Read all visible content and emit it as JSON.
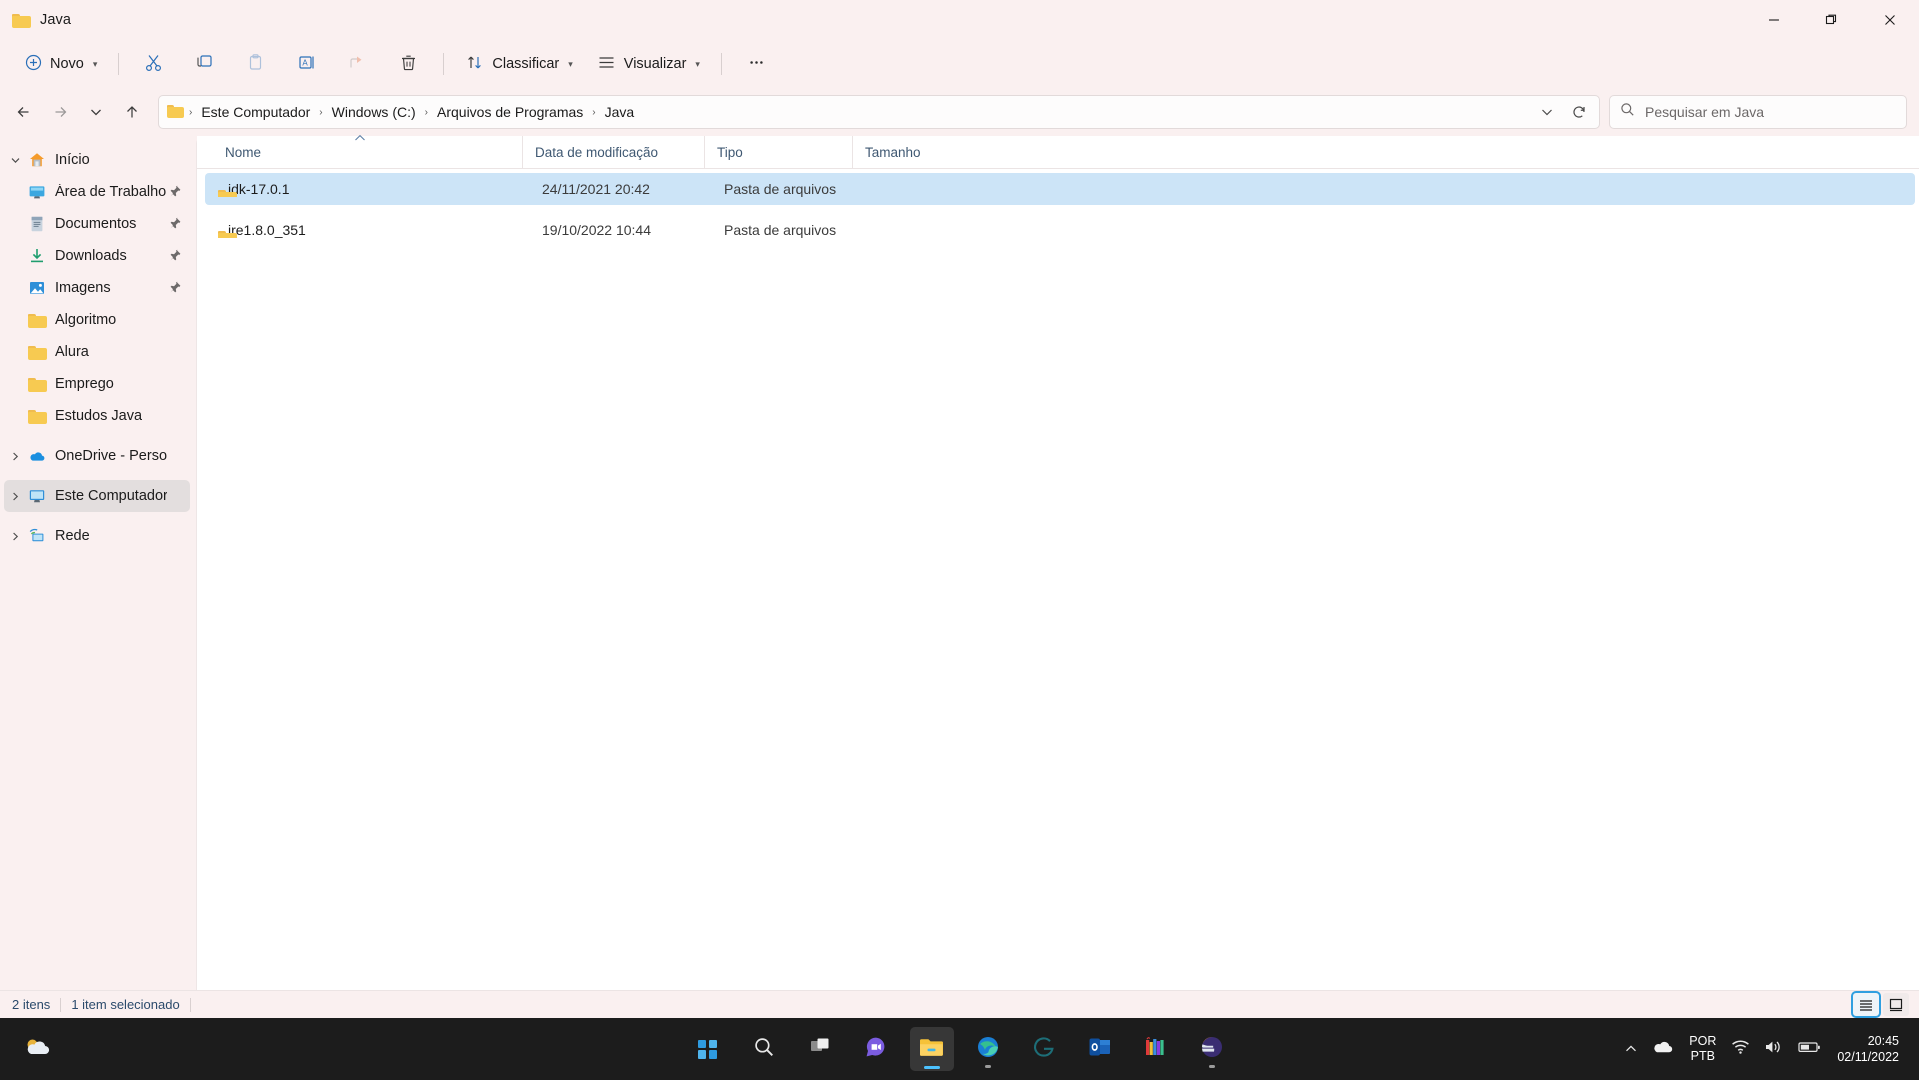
{
  "window": {
    "title": "Java",
    "title_icon": "folder-icon",
    "controls": {
      "minimize": "minimize-icon",
      "restore": "restore-icon",
      "close": "close-icon"
    }
  },
  "toolbar": {
    "new_label": "Novo",
    "new_icon": "plus-circle-icon",
    "cut_icon": "scissors-icon",
    "copy_icon": "copy-icon",
    "paste_icon": "clipboard-icon",
    "rename_icon": "rename-icon",
    "share_icon": "share-icon",
    "delete_icon": "trash-icon",
    "sort_label": "Classificar",
    "sort_icon": "sort-arrows-icon",
    "view_label": "Visualizar",
    "view_icon": "lines-icon",
    "more_label": "···",
    "more_icon": "ellipsis-icon"
  },
  "address": {
    "back_icon": "arrow-left-icon",
    "forward_icon": "arrow-right-icon",
    "recent_icon": "chevron-down-icon",
    "up_icon": "arrow-up-icon",
    "folder_icon": "folder-icon",
    "crumbs": [
      "Este Computador",
      "Windows (C:)",
      "Arquivos de Programas",
      "Java"
    ],
    "separator": "›",
    "history_icon": "chevron-down-icon",
    "refresh_icon": "refresh-icon"
  },
  "search": {
    "icon": "search-icon",
    "placeholder": "Pesquisar em Java",
    "value": ""
  },
  "sidebar": {
    "items": [
      {
        "label": "Início",
        "icon": "home-icon",
        "twisty": "expanded",
        "pinned": false,
        "selected": false,
        "indent": 0
      },
      {
        "label": "Área de Trabalho",
        "icon": "desktop-icon",
        "twisty": "none",
        "pinned": true,
        "selected": false,
        "indent": 1
      },
      {
        "label": "Documentos",
        "icon": "documents-icon",
        "twisty": "none",
        "pinned": true,
        "selected": false,
        "indent": 1
      },
      {
        "label": "Downloads",
        "icon": "download-icon",
        "twisty": "none",
        "pinned": true,
        "selected": false,
        "indent": 1
      },
      {
        "label": "Imagens",
        "icon": "pictures-icon",
        "twisty": "none",
        "pinned": true,
        "selected": false,
        "indent": 1
      },
      {
        "label": "Algoritmo",
        "icon": "folder-icon",
        "twisty": "none",
        "pinned": false,
        "selected": false,
        "indent": 1
      },
      {
        "label": "Alura",
        "icon": "folder-icon",
        "twisty": "none",
        "pinned": false,
        "selected": false,
        "indent": 1
      },
      {
        "label": "Emprego",
        "icon": "folder-icon",
        "twisty": "none",
        "pinned": false,
        "selected": false,
        "indent": 1
      },
      {
        "label": "Estudos Java",
        "icon": "folder-icon",
        "twisty": "none",
        "pinned": false,
        "selected": false,
        "indent": 1
      },
      {
        "label": "OneDrive - Personal",
        "icon": "onedrive-icon",
        "twisty": "collapsed",
        "pinned": false,
        "selected": false,
        "indent": 0
      },
      {
        "label": "Este Computador",
        "icon": "monitor-icon",
        "twisty": "collapsed",
        "pinned": false,
        "selected": true,
        "indent": 0
      },
      {
        "label": "Rede",
        "icon": "network-icon",
        "twisty": "collapsed",
        "pinned": false,
        "selected": false,
        "indent": 0
      }
    ]
  },
  "filelist": {
    "columns": [
      {
        "label": "Nome",
        "sort": "asc",
        "key": "name"
      },
      {
        "label": "Data de modificação",
        "sort": "none",
        "key": "date"
      },
      {
        "label": "Tipo",
        "sort": "none",
        "key": "type"
      },
      {
        "label": "Tamanho",
        "sort": "none",
        "key": "size"
      }
    ],
    "rows": [
      {
        "name": "jdk-17.0.1",
        "date": "24/11/2021 20:42",
        "type": "Pasta de arquivos",
        "size": "",
        "icon": "folder-icon",
        "selected": true
      },
      {
        "name": "jre1.8.0_351",
        "date": "19/10/2022 10:44",
        "type": "Pasta de arquivos",
        "size": "",
        "icon": "folder-icon",
        "selected": false
      }
    ]
  },
  "statusbar": {
    "item_count": "2 itens",
    "selection": "1 item selecionado",
    "view_details_icon": "details-view-icon",
    "view_tiles_icon": "large-icons-view-icon"
  },
  "taskbar": {
    "weather_icon": "weather-icon",
    "items": [
      {
        "name": "start",
        "icon": "windows-logo-icon",
        "state": "idle"
      },
      {
        "name": "search",
        "icon": "search-icon",
        "state": "idle"
      },
      {
        "name": "task-view",
        "icon": "task-view-icon",
        "state": "idle"
      },
      {
        "name": "chat",
        "icon": "chat-icon",
        "state": "idle"
      },
      {
        "name": "file-explorer",
        "icon": "file-explorer-icon",
        "state": "active"
      },
      {
        "name": "edge",
        "icon": "edge-icon",
        "state": "running"
      },
      {
        "name": "app-s",
        "icon": "s-logo-icon",
        "state": "idle"
      },
      {
        "name": "outlook",
        "icon": "outlook-icon",
        "state": "idle"
      },
      {
        "name": "app-books",
        "icon": "books-icon",
        "state": "idle"
      },
      {
        "name": "app-orbit",
        "icon": "orbit-icon",
        "state": "running"
      }
    ],
    "tray": {
      "overflow_icon": "chevron-up-icon",
      "onedrive_icon": "cloud-icon",
      "lang_line1": "POR",
      "lang_line2": "PTB",
      "wifi_icon": "wifi-icon",
      "volume_icon": "speaker-icon",
      "battery_icon": "battery-icon",
      "time": "20:45",
      "date": "02/11/2022"
    }
  },
  "colors": {
    "window_chrome": "#faf0f0",
    "selection_blue": "#cce4f7",
    "accent_blue": "#2f9fe0",
    "folder_yellow": "#f7ca51",
    "taskbar": "#1c1c1c",
    "header_text": "#3f5872"
  }
}
